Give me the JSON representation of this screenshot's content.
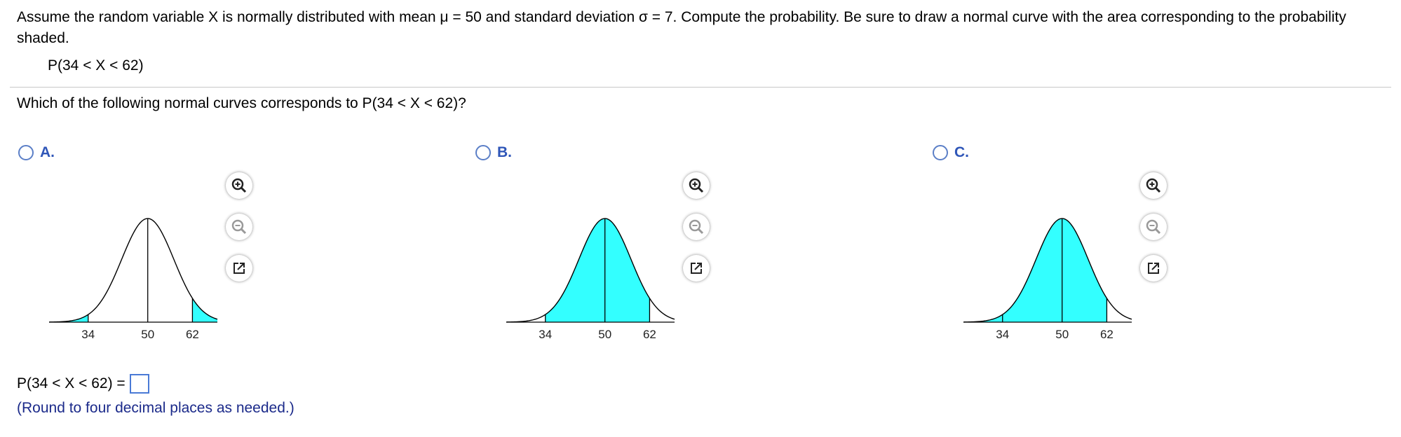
{
  "question": {
    "text": "Assume the random variable X is normally distributed with mean μ = 50 and standard deviation σ = 7. Compute the probability. Be sure to draw a normal curve with the area corresponding to the probability shaded.",
    "expression": "P(34 < X < 62)"
  },
  "prompt": "Which of the following normal curves corresponds to P(34 < X < 62)?",
  "options": [
    {
      "letter": "A.",
      "ticks": [
        "34",
        "50",
        "62"
      ],
      "shading": "tails"
    },
    {
      "letter": "B.",
      "ticks": [
        "34",
        "50",
        "62"
      ],
      "shading": "between"
    },
    {
      "letter": "C.",
      "ticks": [
        "34",
        "50",
        "62"
      ],
      "shading": "left_of_62"
    }
  ],
  "tools": {
    "zoom_in": "zoom-in-icon",
    "zoom_out": "zoom-out-icon",
    "popout": "popout-icon"
  },
  "answer": {
    "label": "P(34 < X < 62) =",
    "value": "",
    "hint": "(Round to four decimal places as needed.)"
  },
  "colors": {
    "shade": "#33ffff",
    "accent": "#2f56b8",
    "hint": "#1b2a8a"
  }
}
